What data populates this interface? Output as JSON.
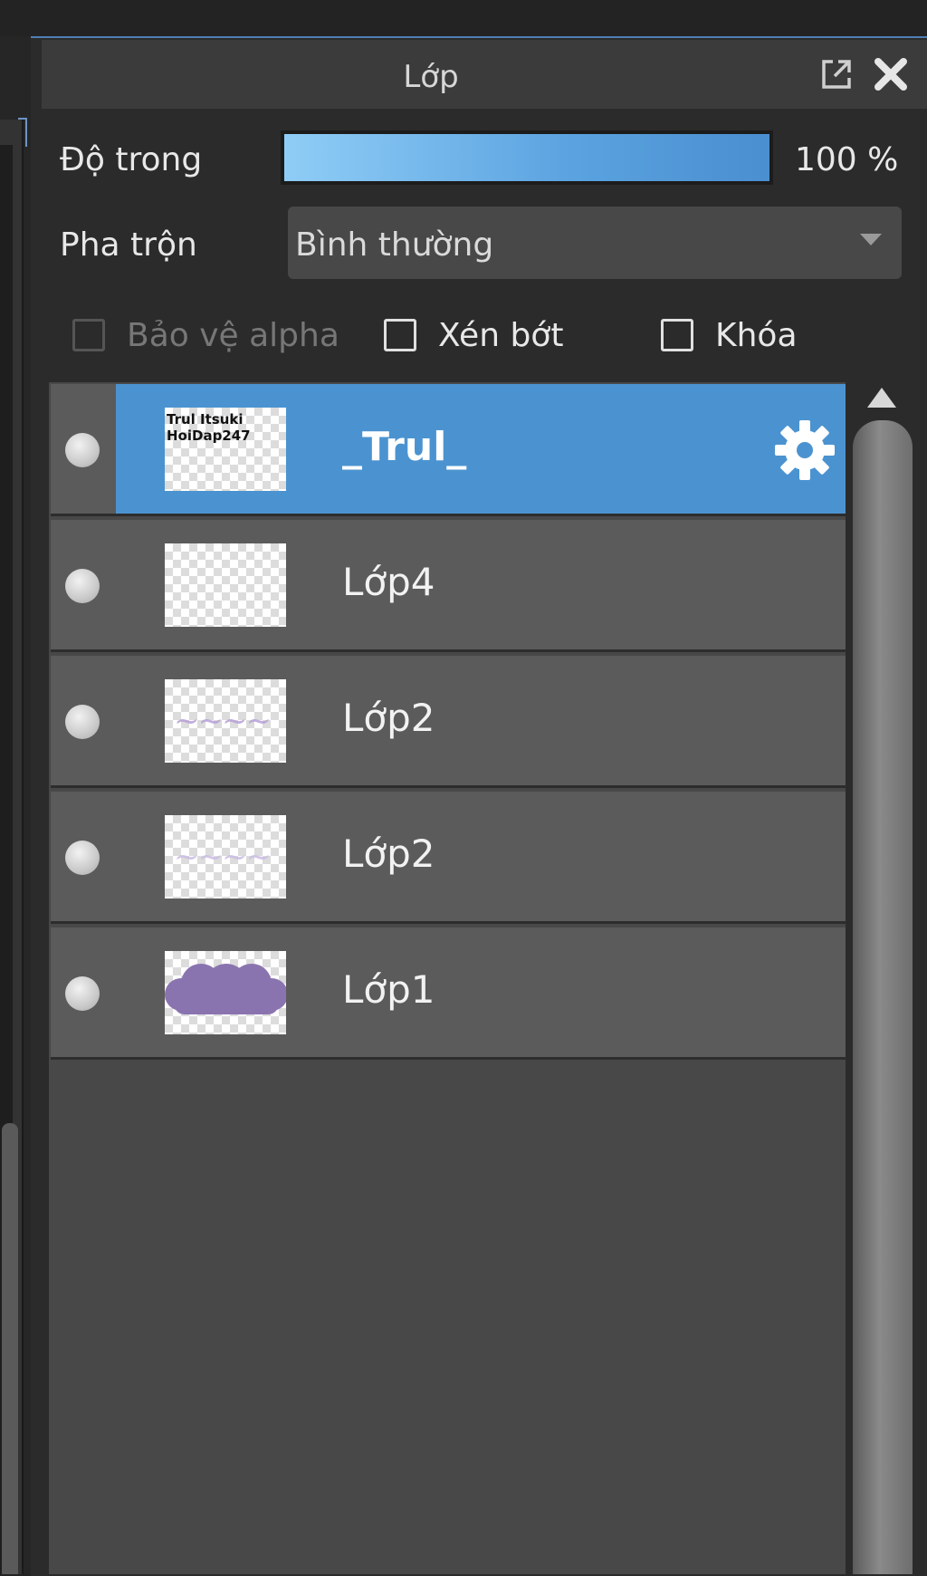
{
  "panel": {
    "title": "Lớp",
    "popout_icon": "popout-icon",
    "close_icon": "close-icon"
  },
  "opacity": {
    "label": "Độ trong",
    "value": 100,
    "value_text": "100 %"
  },
  "blend": {
    "label": "Pha trộn",
    "selected": "Bình thường"
  },
  "options": {
    "protect_alpha": {
      "label": "Bảo vệ alpha",
      "checked": false,
      "enabled": false
    },
    "clipping": {
      "label": "Xén bớt",
      "checked": false,
      "enabled": true
    },
    "lock": {
      "label": "Khóa",
      "checked": false,
      "enabled": true
    }
  },
  "layers": [
    {
      "name": "_Trul_",
      "selected": true,
      "visible": true,
      "thumb_text": "Trul Itsuki HoiDap247",
      "settings_icon": "gear-icon"
    },
    {
      "name": "Lớp4",
      "selected": false,
      "visible": true
    },
    {
      "name": "Lớp2",
      "selected": false,
      "visible": true
    },
    {
      "name": "Lớp2",
      "selected": false,
      "visible": true
    },
    {
      "name": "Lớp1",
      "selected": false,
      "visible": true
    }
  ],
  "colors": {
    "accent": "#4b93d0",
    "panel_bg": "#2b2b2b",
    "row_bg": "#5b5b5b",
    "cloud": "#8a74b0"
  }
}
